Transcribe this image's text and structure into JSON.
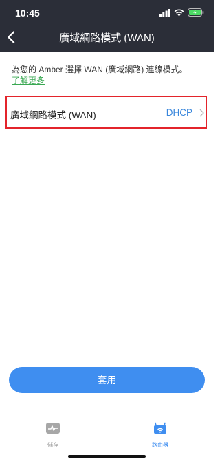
{
  "status_bar": {
    "time": "10:45"
  },
  "nav": {
    "title": "廣域網路模式 (WAN)"
  },
  "main": {
    "description": "為您的 Amber 選擇 WAN (廣域網路) 連線模式。",
    "learn_more": "了解更多",
    "wan_row": {
      "label": "廣域網路模式 (WAN)",
      "value": "DHCP"
    },
    "apply_button": "套用"
  },
  "tabbar": {
    "tabs": [
      {
        "label": "儲存",
        "icon": "storage-icon",
        "active": false
      },
      {
        "label": "路由器",
        "icon": "router-icon",
        "active": true
      }
    ]
  },
  "colors": {
    "header_bg": "#2b2e38",
    "accent_blue": "#3f8ef0",
    "link_green": "#3aa853",
    "highlight_red": "#e3242b",
    "inactive_gray": "#9a9a9a"
  }
}
